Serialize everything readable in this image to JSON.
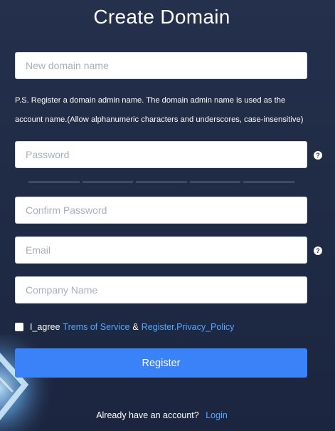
{
  "page": {
    "title": "Create Domain"
  },
  "form": {
    "domain_name_placeholder": "New domain name",
    "note_line1": "P.S. Register a domain admin name. The domain admin name is used as the",
    "note_line2": "account name.(Allow alphanumeric characters and underscores, case-insensitive)",
    "password_placeholder": "Password",
    "confirm_password_placeholder": "Confirm Password",
    "email_placeholder": "Email",
    "company_name_placeholder": "Company Name",
    "help_icon_glyph": "?",
    "password_strength_segments": 5
  },
  "agreement": {
    "prefix": "I_agree",
    "terms_link": "Trems of Service",
    "separator": "&",
    "privacy_link": "Register.Privacy_Policy",
    "checked": false
  },
  "actions": {
    "register_label": "Register"
  },
  "footer": {
    "prompt": "Already have an account?",
    "login_link": "Login"
  },
  "colors": {
    "background": "#1f2a45",
    "primary_button": "#3a82f7",
    "link": "#5aa8ff"
  }
}
